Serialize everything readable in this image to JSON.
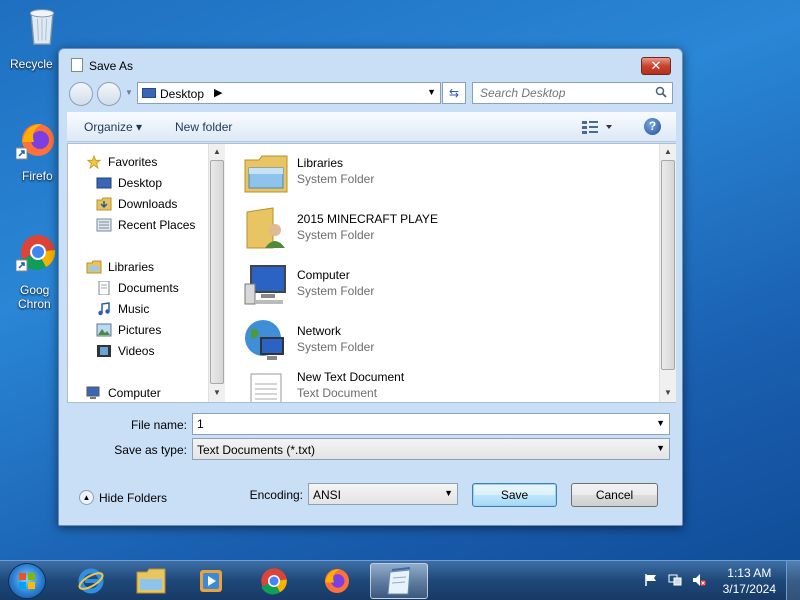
{
  "desktop": {
    "icons": [
      {
        "label": "Recycle",
        "icon": "recycle-bin-icon"
      },
      {
        "label": "Firefo",
        "icon": "firefox-icon"
      },
      {
        "label": "Goog",
        "label2": "Chron",
        "icon": "chrome-icon"
      }
    ]
  },
  "dialog": {
    "title": "Save As",
    "close_label": "✕",
    "address": {
      "location": "Desktop",
      "chevron": "▶",
      "dropdown": "▼"
    },
    "refresh_glyph": "⇆",
    "search": {
      "placeholder": "Search Desktop"
    },
    "toolbar": {
      "organize_label": "Organize ▾",
      "new_folder_label": "New folder",
      "help_label": "?"
    },
    "nav": {
      "favorites_label": "Favorites",
      "favorites_items": [
        "Desktop",
        "Downloads",
        "Recent Places"
      ],
      "libraries_label": "Libraries",
      "libraries_items": [
        "Documents",
        "Music",
        "Pictures",
        "Videos"
      ],
      "computer_label": "Computer"
    },
    "files": [
      {
        "name": "Libraries",
        "type": "System Folder",
        "icon": "libraries-folder-icon"
      },
      {
        "name": "2015 MINECRAFT PLAYE",
        "type": "System Folder",
        "icon": "user-folder-icon"
      },
      {
        "name": "Computer",
        "type": "System Folder",
        "icon": "computer-icon"
      },
      {
        "name": "Network",
        "type": "System Folder",
        "icon": "network-icon"
      },
      {
        "name": "New Text Document",
        "type": "Text Document",
        "icon": "text-document-icon"
      }
    ],
    "form": {
      "file_name_label": "File name:",
      "file_name_value": "1",
      "save_as_type_label": "Save as type:",
      "save_as_type_value": "Text Documents (*.txt)",
      "encoding_label": "Encoding:",
      "encoding_value": "ANSI",
      "save_label": "Save",
      "cancel_label": "Cancel",
      "hide_folders_label": "Hide Folders"
    }
  },
  "taskbar": {
    "apps": [
      "start-orb",
      "internet-explorer",
      "file-explorer",
      "media-player",
      "chrome",
      "firefox",
      "notepad"
    ],
    "clock_time": "1:13 AM",
    "clock_date": "3/17/2024"
  },
  "colors": {
    "desktop_bg": "#1f6fc0",
    "dialog_frame": "#c9dff5",
    "taskbar": "#1e4879"
  }
}
